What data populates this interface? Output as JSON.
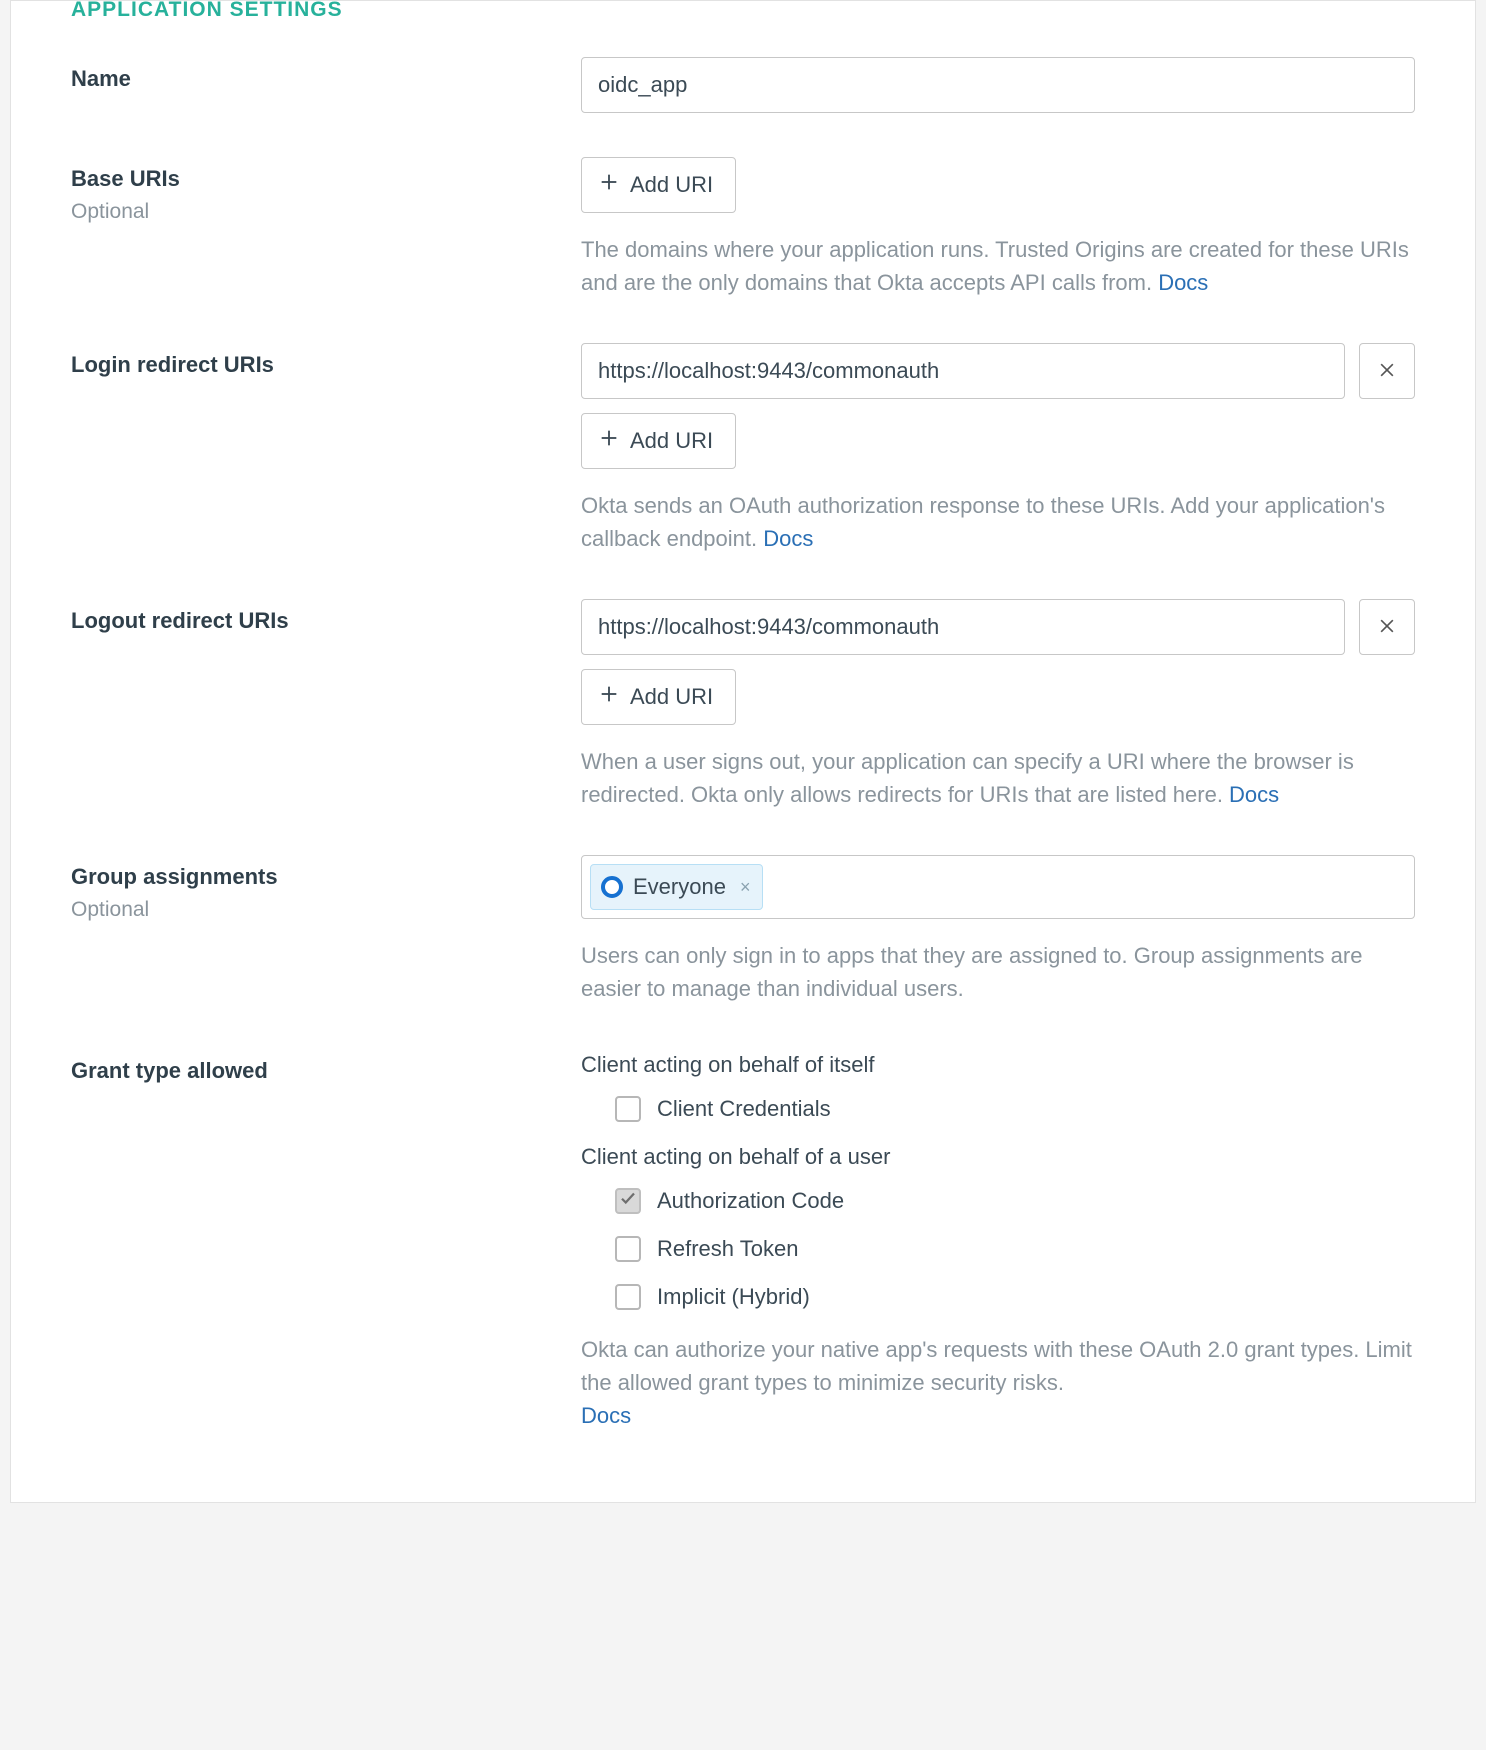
{
  "section_title": "APPLICATION SETTINGS",
  "name": {
    "label": "Name",
    "value": "oidc_app"
  },
  "base_uris": {
    "label": "Base URIs",
    "optional": "Optional",
    "add_label": "Add URI",
    "help_pre": "The domains where your application runs. Trusted Origins are created for these URIs and are the only domains that Okta accepts API calls from. ",
    "docs": "Docs"
  },
  "login_redirect": {
    "label": "Login redirect URIs",
    "value": "https://localhost:9443/commonauth",
    "add_label": "Add URI",
    "help_pre": "Okta sends an OAuth authorization response to these URIs. Add your application's callback endpoint. ",
    "docs": "Docs"
  },
  "logout_redirect": {
    "label": "Logout redirect URIs",
    "value": "https://localhost:9443/commonauth",
    "add_label": "Add URI",
    "help_pre": "When a user signs out, your application can specify a URI where the browser is redirected. Okta only allows redirects for URIs that are listed here. ",
    "docs": "Docs"
  },
  "group_assignments": {
    "label": "Group assignments",
    "optional": "Optional",
    "tag": "Everyone",
    "help": "Users can only sign in to apps that they are assigned to. Group assignments are easier to manage than individual users."
  },
  "grant_type": {
    "label": "Grant type allowed",
    "self_heading": "Client acting on behalf of itself",
    "user_heading": "Client acting on behalf of a user",
    "opts": {
      "client_credentials": "Client Credentials",
      "authorization_code": "Authorization Code",
      "refresh_token": "Refresh Token",
      "implicit": "Implicit (Hybrid)"
    },
    "help_pre": "Okta can authorize your native app's requests with these OAuth 2.0 grant types. Limit the allowed grant types to minimize security risks. ",
    "docs": "Docs"
  }
}
